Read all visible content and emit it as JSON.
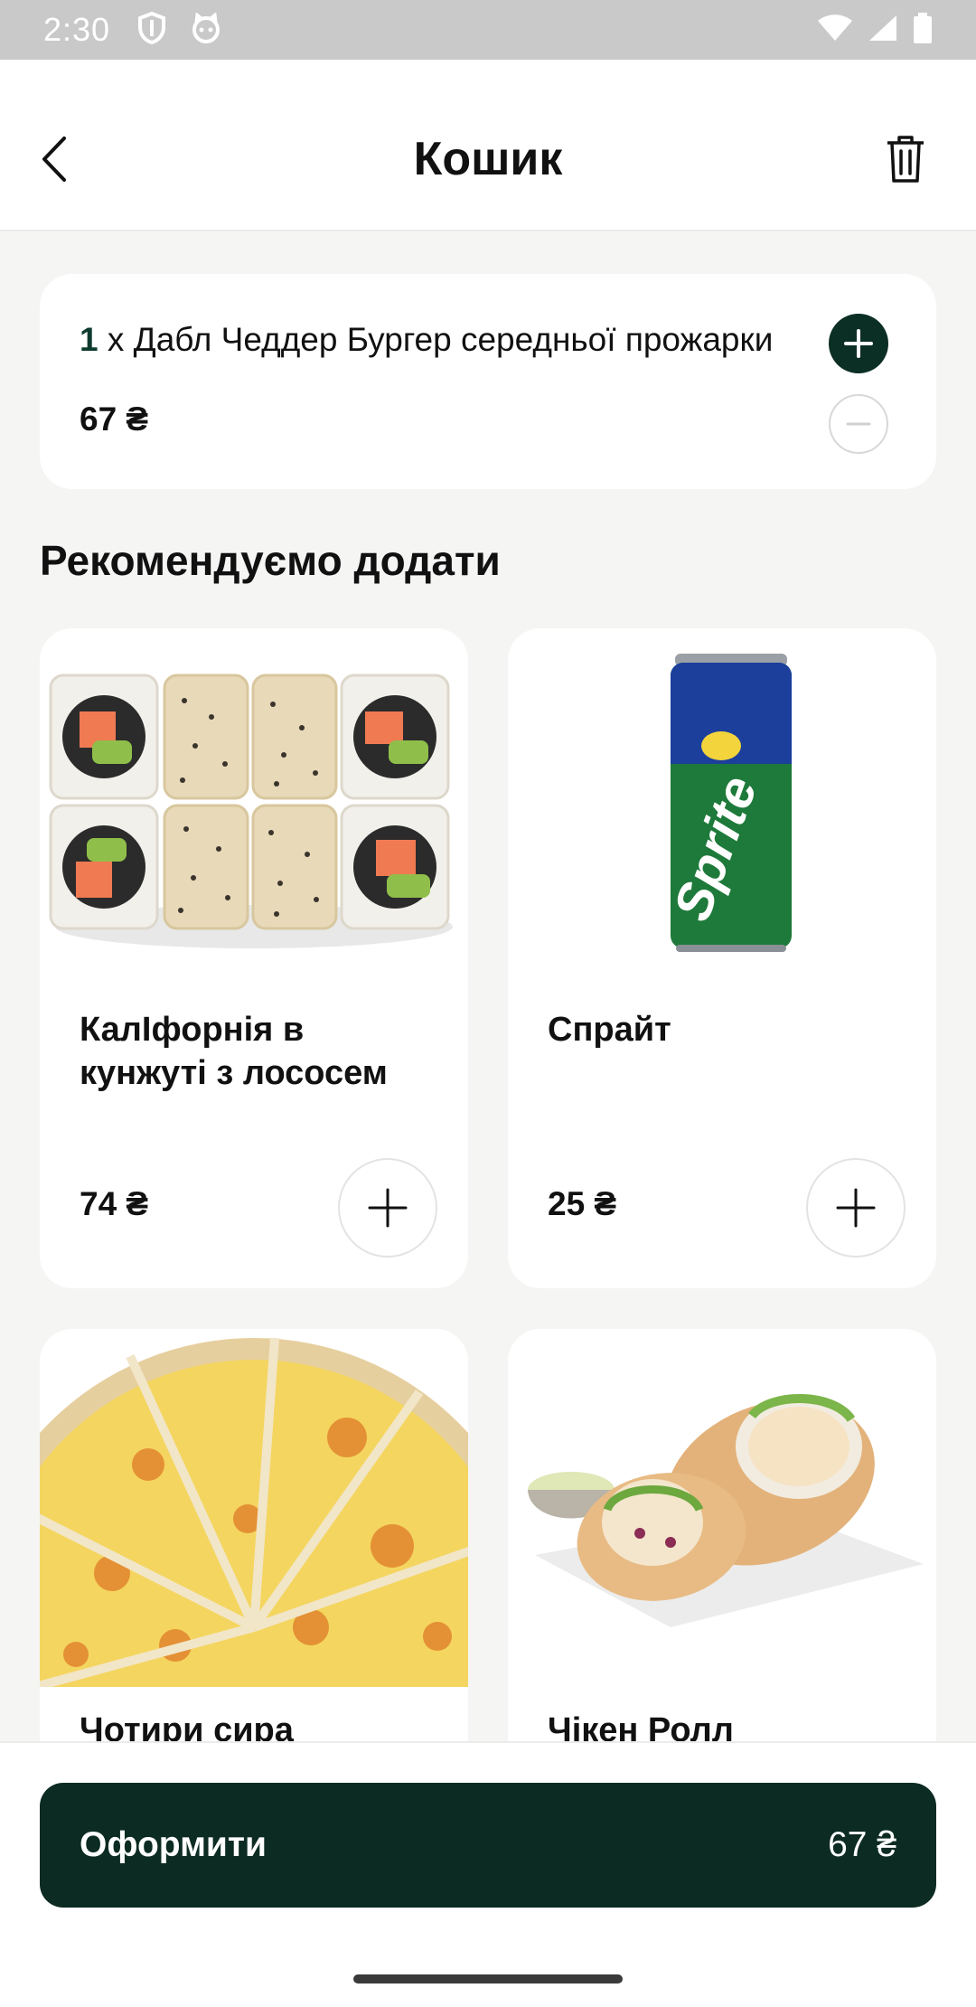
{
  "status_bar": {
    "time": "2:30",
    "left_icons": [
      "shield-icon",
      "cat-icon"
    ],
    "right_icons": [
      "wifi-icon",
      "signal-icon",
      "battery-icon"
    ]
  },
  "header": {
    "title": "Кошик",
    "back_icon": "chevron-left-icon",
    "delete_icon": "trash-icon"
  },
  "cart": {
    "items": [
      {
        "quantity": "1",
        "separator": " x ",
        "name": "Дабл Чеддер Бургер середньої прожарки",
        "price": "67 ₴"
      }
    ]
  },
  "recommendations": {
    "title": "Рекомендуємо додати",
    "products": [
      {
        "name": "КалІфорнія в кунжуті з лососем",
        "price": "74 ₴",
        "image": "sushi-rolls"
      },
      {
        "name": "Спрайт",
        "price": "25 ₴",
        "image": "sprite-can",
        "image_text": "Sprite"
      },
      {
        "name": "Чотири сира",
        "price": "",
        "image": "pizza"
      },
      {
        "name": "Чікен Ролл",
        "price": "",
        "image": "chicken-wrap"
      }
    ]
  },
  "checkout": {
    "label": "Оформити",
    "total": "67 ₴"
  },
  "colors": {
    "accent": "#0c2b22",
    "background": "#f5f5f4",
    "card": "#ffffff"
  }
}
